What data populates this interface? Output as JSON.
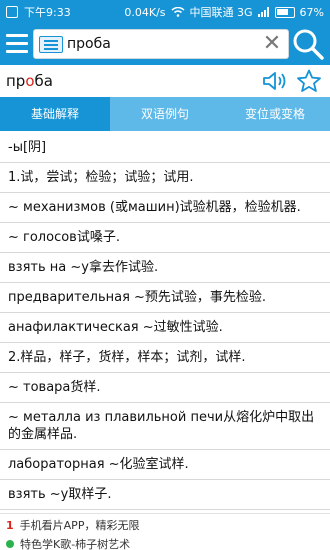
{
  "status_bar": {
    "time": "下午9:33",
    "speed": "0.04K/s",
    "carrier": "中国联通 3G",
    "battery": "67%"
  },
  "search": {
    "value": "проба"
  },
  "word": {
    "before": "пр",
    "accent": "о",
    "after": "ба"
  },
  "tabs": [
    {
      "label": "基础解释"
    },
    {
      "label": "双语例句"
    },
    {
      "label": "变位或变格"
    }
  ],
  "entries": [
    "-ы[阴]",
    "1.试，尝试；检验；试验；试用.",
    "~ механизмов (或машин)试验机器，检验机器.",
    "~ голосов试嗓子.",
    "взять на ~у拿去作试验.",
    "предварительная ~预先试验，事先检验.",
    "анафилактическая ~过敏性试验.",
    "2.样品，样子，货样，样本；试剂，试样.",
    "~ товара货样.",
    "~ металла из плавильной печи从熔化炉中取出的金属样品.",
    "лабораторная ~化验室试样.",
    "взять ~у取样子."
  ],
  "ad": {
    "line1_num": "1",
    "line1_text": "手机看片APP，精彩无限",
    "line2_text": "特色学K歌-柿子树艺术"
  },
  "colors": {
    "primary": "#1694d6",
    "tab_inactive": "#5fb9e8",
    "accent_red": "#d9251c"
  }
}
